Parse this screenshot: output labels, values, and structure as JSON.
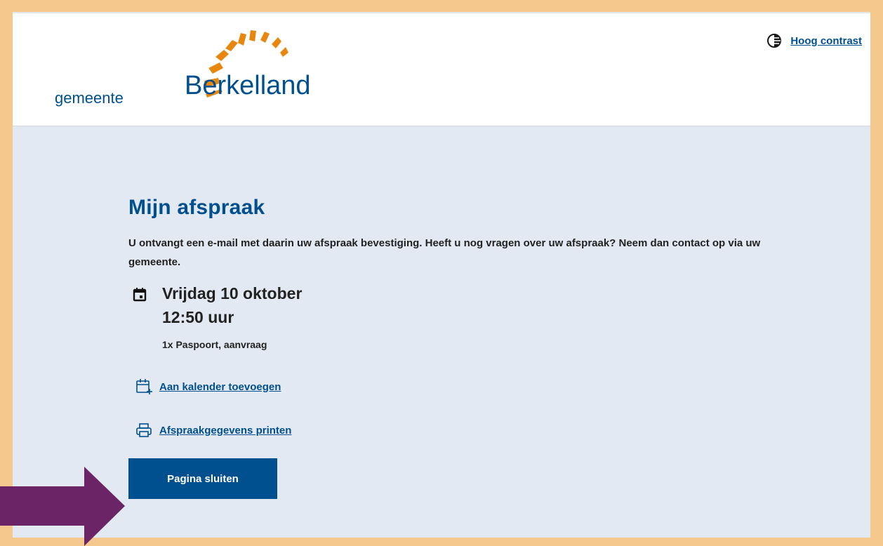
{
  "header": {
    "logo_small": "gemeente",
    "logo_big": "Berkelland",
    "contrast_label": "Hoog contrast",
    "contrast_icon": "contrast-icon"
  },
  "main": {
    "title": "Mijn afspraak",
    "intro": "U ontvangt een e-mail met daarin uw afspraak bevestiging. Heeft u nog vragen over uw afspraak? Neem dan contact op via uw gemeente.",
    "date": "Vrijdag 10 oktober",
    "time": "12:50 uur",
    "product": "1x Paspoort, aanvraag",
    "actions": [
      {
        "label": "Aan kalender toevoegen",
        "icon": "calendar-add-icon"
      },
      {
        "label": "Afspraakgegevens printen",
        "icon": "printer-icon"
      }
    ],
    "close_button": "Pagina sluiten"
  },
  "colors": {
    "brand": "#004f8f",
    "accent": "#e8870f",
    "frame": "#f5c88e",
    "background": "#e3e9f2",
    "annotation_arrow": "#6b2466"
  }
}
